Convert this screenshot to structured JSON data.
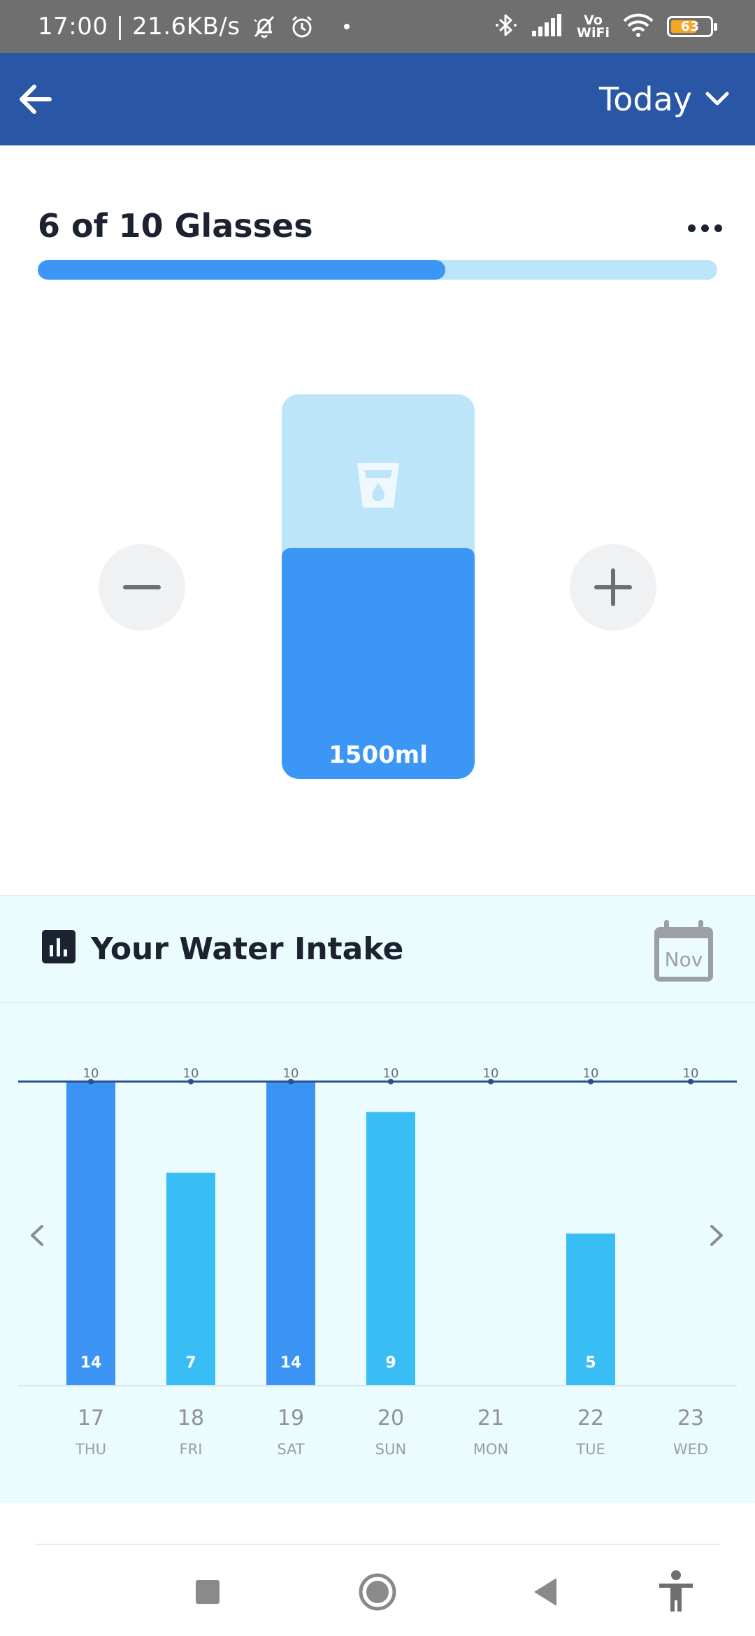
{
  "status_bar": {
    "time_speed": "17:00 | 21.6KB/s",
    "vowifi_top": "Vo",
    "vowifi_bottom": "WiFi",
    "battery_level": "63",
    "icons": [
      "muted-bell-icon",
      "alarm-icon",
      "bluetooth-icon",
      "signal-icon",
      "wifi-icon",
      "battery-icon"
    ]
  },
  "app_bar": {
    "period": "Today"
  },
  "goal": {
    "title": "6 of 10 Glasses",
    "consumed": 6,
    "target": 10
  },
  "glass": {
    "volume": "1500ml",
    "fill_fraction": 0.6
  },
  "intake": {
    "title": "Your Water Intake",
    "calendar_month": "Nov"
  },
  "chart_data": {
    "type": "bar",
    "title": "Your Water Intake",
    "categories": [
      "17",
      "18",
      "19",
      "20",
      "21",
      "22",
      "23"
    ],
    "weekdays": [
      "THU",
      "FRI",
      "SAT",
      "SUN",
      "MON",
      "TUE",
      "WED"
    ],
    "values": [
      14,
      7,
      14,
      9,
      0,
      5,
      0
    ],
    "value_labels": [
      "14",
      "7",
      "14",
      "9",
      "",
      "5",
      ""
    ],
    "goal_value": 10,
    "goal_labels": [
      "10",
      "10",
      "10",
      "10",
      "10",
      "10",
      "10"
    ],
    "ylim": [
      0,
      10
    ],
    "goal_met_color": "#3b93f3",
    "goal_unmet_color": "#38bdf5",
    "goal_line_color": "#2a4f8f",
    "grid": false,
    "legend": "none"
  },
  "colors": {
    "app_bar": "#2a56a6",
    "accent": "#3b96f5",
    "light_accent": "#bde5fa",
    "intake_background": "#eafcfe"
  }
}
